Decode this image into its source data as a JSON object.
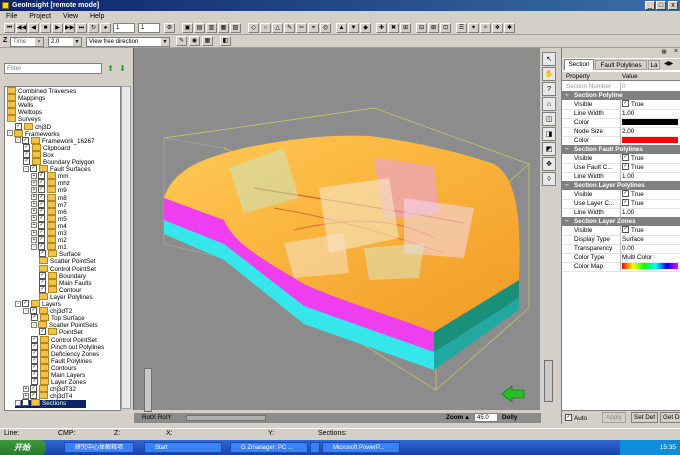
{
  "window": {
    "title": "GeoInsight [remote mode]",
    "buttons": [
      "_",
      "□",
      "x"
    ]
  },
  "menu": [
    "File",
    "Project",
    "View",
    "Help"
  ],
  "toolbar1": {
    "frame_a": "1",
    "frame_b": "1"
  },
  "toolbar2": {
    "axis": "Z",
    "time": "Time",
    "scale": "2.0",
    "view_mode": "View free direction"
  },
  "left": {
    "filter_placeholder": "Filter"
  },
  "tree": [
    {
      "label": "Combined Traverses",
      "lv": 0,
      "cb": false,
      "ex": ""
    },
    {
      "label": "Mappings",
      "lv": 0,
      "cb": false,
      "ex": ""
    },
    {
      "label": "Wells",
      "lv": 0,
      "cb": false,
      "ex": ""
    },
    {
      "label": "Welltops",
      "lv": 0,
      "cb": false,
      "ex": ""
    },
    {
      "label": "Surveys",
      "lv": 0,
      "cb": false,
      "ex": ""
    },
    {
      "label": "chj3D",
      "lv": 1,
      "cb": true,
      "ex": ""
    },
    {
      "label": "Frameworks",
      "lv": 0,
      "cb": false,
      "ex": "-"
    },
    {
      "label": "Framework_16267",
      "lv": 1,
      "cb": true,
      "ex": "-"
    },
    {
      "label": "Clipboard",
      "lv": 2,
      "cb": true,
      "ex": ""
    },
    {
      "label": "Box",
      "lv": 2,
      "cb": true,
      "ex": ""
    },
    {
      "label": "Boundary Polygon",
      "lv": 2,
      "cb": true,
      "ex": ""
    },
    {
      "label": "Fault Surfaces",
      "lv": 2,
      "cb": true,
      "ex": "-"
    },
    {
      "label": "mm",
      "lv": 3,
      "cb": true,
      "ex": "+"
    },
    {
      "label": "mhz",
      "lv": 3,
      "cb": true,
      "ex": "+"
    },
    {
      "label": "m9",
      "lv": 3,
      "cb": true,
      "ex": "+"
    },
    {
      "label": "m8",
      "lv": 3,
      "cb": true,
      "ex": "+"
    },
    {
      "label": "m7",
      "lv": 3,
      "cb": true,
      "ex": "+"
    },
    {
      "label": "m6",
      "lv": 3,
      "cb": true,
      "ex": "+"
    },
    {
      "label": "m5",
      "lv": 3,
      "cb": true,
      "ex": "+"
    },
    {
      "label": "m4",
      "lv": 3,
      "cb": true,
      "ex": "+"
    },
    {
      "label": "m3",
      "lv": 3,
      "cb": true,
      "ex": "+"
    },
    {
      "label": "m2",
      "lv": 3,
      "cb": true,
      "ex": "+"
    },
    {
      "label": "m1",
      "lv": 3,
      "cb": true,
      "ex": "-"
    },
    {
      "label": "Surface",
      "lv": 4,
      "cb": true,
      "ex": ""
    },
    {
      "label": "Scatter PointSet",
      "lv": 4,
      "cb": false,
      "ex": ""
    },
    {
      "label": "Control PointSet",
      "lv": 4,
      "cb": false,
      "ex": ""
    },
    {
      "label": "Boundary",
      "lv": 4,
      "cb": true,
      "ex": ""
    },
    {
      "label": "Main Faults",
      "lv": 4,
      "cb": true,
      "ex": ""
    },
    {
      "label": "Contour",
      "lv": 4,
      "cb": true,
      "ex": ""
    },
    {
      "label": "Layer Polylines",
      "lv": 4,
      "cb": false,
      "ex": ""
    },
    {
      "label": "Layers",
      "lv": 1,
      "cb": true,
      "ex": "-"
    },
    {
      "label": "chj3dT2",
      "lv": 2,
      "cb": true,
      "ex": "-"
    },
    {
      "label": "Top Surface",
      "lv": 3,
      "cb": true,
      "ex": ""
    },
    {
      "label": "Scatter PointSets",
      "lv": 3,
      "cb": false,
      "ex": "-"
    },
    {
      "label": "PointSet",
      "lv": 4,
      "cb": true,
      "ex": ""
    },
    {
      "label": "Control PointSet",
      "lv": 3,
      "cb": true,
      "ex": ""
    },
    {
      "label": "Pinch out Polylines",
      "lv": 3,
      "cb": true,
      "ex": ""
    },
    {
      "label": "Deficiency Zones",
      "lv": 3,
      "cb": true,
      "ex": ""
    },
    {
      "label": "Fault Polylines",
      "lv": 3,
      "cb": true,
      "ex": ""
    },
    {
      "label": "Contours",
      "lv": 3,
      "cb": true,
      "ex": ""
    },
    {
      "label": "Main Layers",
      "lv": 3,
      "cb": true,
      "ex": ""
    },
    {
      "label": "Layer Zones",
      "lv": 3,
      "cb": true,
      "ex": ""
    },
    {
      "label": "chj3dT32",
      "lv": 2,
      "cb": true,
      "ex": "+"
    },
    {
      "label": "chj3dT4",
      "lv": 2,
      "cb": true,
      "ex": "+"
    },
    {
      "label": "Sections",
      "lv": 1,
      "cb": true,
      "ex": "+",
      "selected": true
    }
  ],
  "viewport": {
    "rotx_label": "RotX RotY",
    "zoom_label": "Zoom",
    "zoom_value": "45.0",
    "dolly_label": "Dolly"
  },
  "props": {
    "tabs": [
      "Section",
      "Fault Polylines",
      "La"
    ],
    "header": {
      "property": "Property",
      "value": "Value"
    },
    "rows": [
      {
        "type": "plain",
        "name": "Section Number",
        "value": "0",
        "grey": true
      },
      {
        "type": "sect",
        "name": "Section Polyline"
      },
      {
        "type": "bool",
        "name": "Visible",
        "value": "True"
      },
      {
        "type": "plain",
        "name": "Line Width",
        "value": "1.00"
      },
      {
        "type": "color",
        "name": "Color",
        "color": "#000000"
      },
      {
        "type": "plain",
        "name": "Node Size",
        "value": "2.00"
      },
      {
        "type": "color",
        "name": "Color",
        "color": "#ff0000"
      },
      {
        "type": "sect",
        "name": "Section Fault Polylines"
      },
      {
        "type": "bool",
        "name": "Visible",
        "value": "True"
      },
      {
        "type": "bool",
        "name": "Use Fault C...",
        "value": "True"
      },
      {
        "type": "plain",
        "name": "Line Width",
        "value": "1.00"
      },
      {
        "type": "sect",
        "name": "Section Layer Polylines"
      },
      {
        "type": "bool",
        "name": "Visible",
        "value": "True"
      },
      {
        "type": "bool",
        "name": "Use Layer C...",
        "value": "True"
      },
      {
        "type": "plain",
        "name": "Line Width",
        "value": "1.00"
      },
      {
        "type": "sect",
        "name": "Section Layer Zones"
      },
      {
        "type": "bool",
        "name": "Visible",
        "value": "True"
      },
      {
        "type": "plain",
        "name": "Display Type",
        "value": "Surface"
      },
      {
        "type": "plain",
        "name": "Transparency",
        "value": "0.00"
      },
      {
        "type": "plain",
        "name": "Color Type",
        "value": "Multi Color"
      },
      {
        "type": "ramp",
        "name": "Color Map"
      }
    ],
    "bottom": {
      "auto": "Auto",
      "apply": "Apply",
      "set_def": "Set Def",
      "get_def": "Get De"
    }
  },
  "status": {
    "line": "Line:",
    "cmp": "CMP:",
    "z": "Z:",
    "x": "X:",
    "y": "Y:",
    "sections": "Sections:"
  },
  "taskbar": {
    "start": "开始",
    "tasks": [
      "研究中心体解释项",
      "Start",
      "G Zmanager: PC ...",
      "",
      "Microsoft PowerP..."
    ],
    "clock": "15:35"
  },
  "colors": {
    "surface_top": "#fdb43a",
    "layer_magenta": "#ee3ef0",
    "layer_cyan": "#35e6ea",
    "selection": "#0a246a"
  }
}
